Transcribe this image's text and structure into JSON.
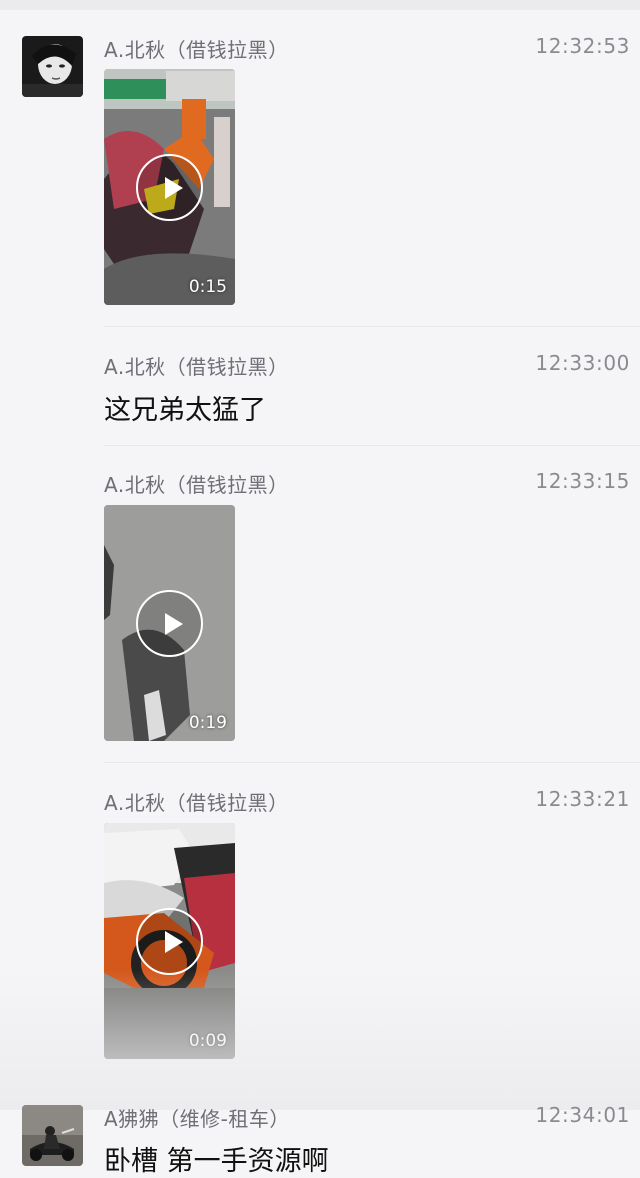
{
  "colors": {
    "background": "#f5f5f7",
    "sender": "#6f6f78",
    "time": "#8a8a90",
    "text": "#111111"
  },
  "messages": [
    {
      "sender": "A.北秋（借钱拉黑）",
      "time": "12:32:53",
      "type": "video",
      "duration": "0:15",
      "avatar": "avatar-face-icon"
    },
    {
      "sender": "A.北秋（借钱拉黑）",
      "time": "12:33:00",
      "type": "text",
      "text": "这兄弟太猛了"
    },
    {
      "sender": "A.北秋（借钱拉黑）",
      "time": "12:33:15",
      "type": "video",
      "duration": "0:19"
    },
    {
      "sender": "A.北秋（借钱拉黑）",
      "time": "12:33:21",
      "type": "video",
      "duration": "0:09"
    },
    {
      "sender": "A狒狒（维修-租车）",
      "time": "12:34:01",
      "type": "text",
      "text": "卧槽 第一手资源啊",
      "avatar": "avatar-rider-icon"
    }
  ]
}
